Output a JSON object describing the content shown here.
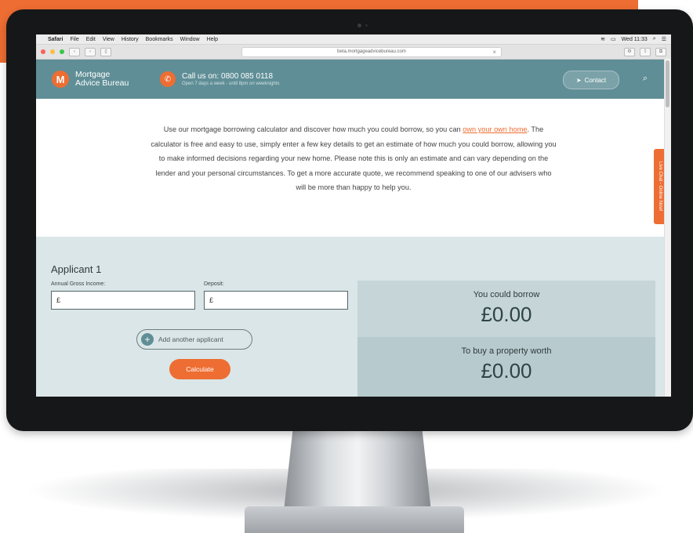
{
  "mac_menubar": {
    "app": "Safari",
    "items": [
      "File",
      "Edit",
      "View",
      "History",
      "Bookmarks",
      "Window",
      "Help"
    ],
    "clock": "Wed 11:33"
  },
  "browser": {
    "url": "beta.mortgageadvicebureau.com"
  },
  "header": {
    "logo_line1": "Mortgage",
    "logo_line2": "Advice Bureau",
    "call_label": "Call us on: 0800 085 0118",
    "call_hours": "Open 7 days a week - until 8pm on weeknights",
    "contact_label": "Contact"
  },
  "intro": {
    "text_before_link": "Use our mortgage borrowing calculator and discover how much you could borrow, so you can",
    "link_text": "own your own home",
    "text_after_link": ". The calculator is free and easy to use, simply enter a few key details to get an estimate of how much you could borrow, allowing you to make informed decisions regarding your new home. Please note this is only an estimate and can vary depending on the lender and your personal circumstances. To get a more accurate quote, we recommend speaking to one of our advisers who will be more than happy to help you."
  },
  "live_chat": "Live Chat - Online Now!",
  "calculator": {
    "applicant_title": "Applicant 1",
    "income_label": "Annual Gross Income:",
    "income_value": "£",
    "deposit_label": "Deposit:",
    "deposit_value": "£",
    "add_applicant": "Add another applicant",
    "calculate": "Calculate",
    "borrow_label": "You could borrow",
    "borrow_value": "£0.00",
    "property_label": "To buy a property worth",
    "property_value": "£0.00"
  },
  "colors": {
    "brand_orange": "#ee6d32",
    "header_teal": "#5f8e96",
    "calc_bg": "#dbe6e8"
  }
}
